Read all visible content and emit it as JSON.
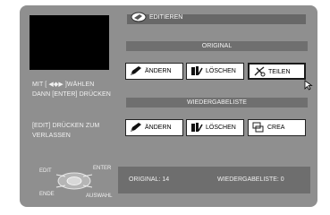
{
  "header": {
    "title": "EDITIEREN",
    "icon": "edit-hand-icon"
  },
  "sidebar": {
    "hint_select": "MIT [ ◀◆▶ ]WÄHLEN\nDANN [ENTER] DRÜCKEN",
    "hint_exit": "[EDIT] DRÜCKEN ZUM\nVERLASSEN"
  },
  "original": {
    "label": "ORIGINAL",
    "buttons": [
      {
        "label": "ÄNDERN",
        "icon": "pencil-icon"
      },
      {
        "label": "LÖSCHEN",
        "icon": "delete-icon"
      },
      {
        "label": "TEILEN",
        "icon": "split-icon",
        "selected": true
      }
    ]
  },
  "playlist": {
    "label": "WIEDERGABELISTE",
    "buttons": [
      {
        "label": "ÄNDERN",
        "icon": "pencil-icon"
      },
      {
        "label": "LÖSCHEN",
        "icon": "delete-icon"
      },
      {
        "label": "CREA",
        "icon": "create-icon"
      }
    ]
  },
  "status": {
    "original": "ORIGINAL: 14",
    "playlist": "WIEDERGABELISTE: 0"
  },
  "remote": {
    "edit": "EDIT",
    "enter": "ENTER",
    "end": "ENDE",
    "select": "AUSWAHL"
  },
  "colors": {
    "screen": "#8f8f8f",
    "bar": "#6f6f6f",
    "button": "#ffffff"
  }
}
